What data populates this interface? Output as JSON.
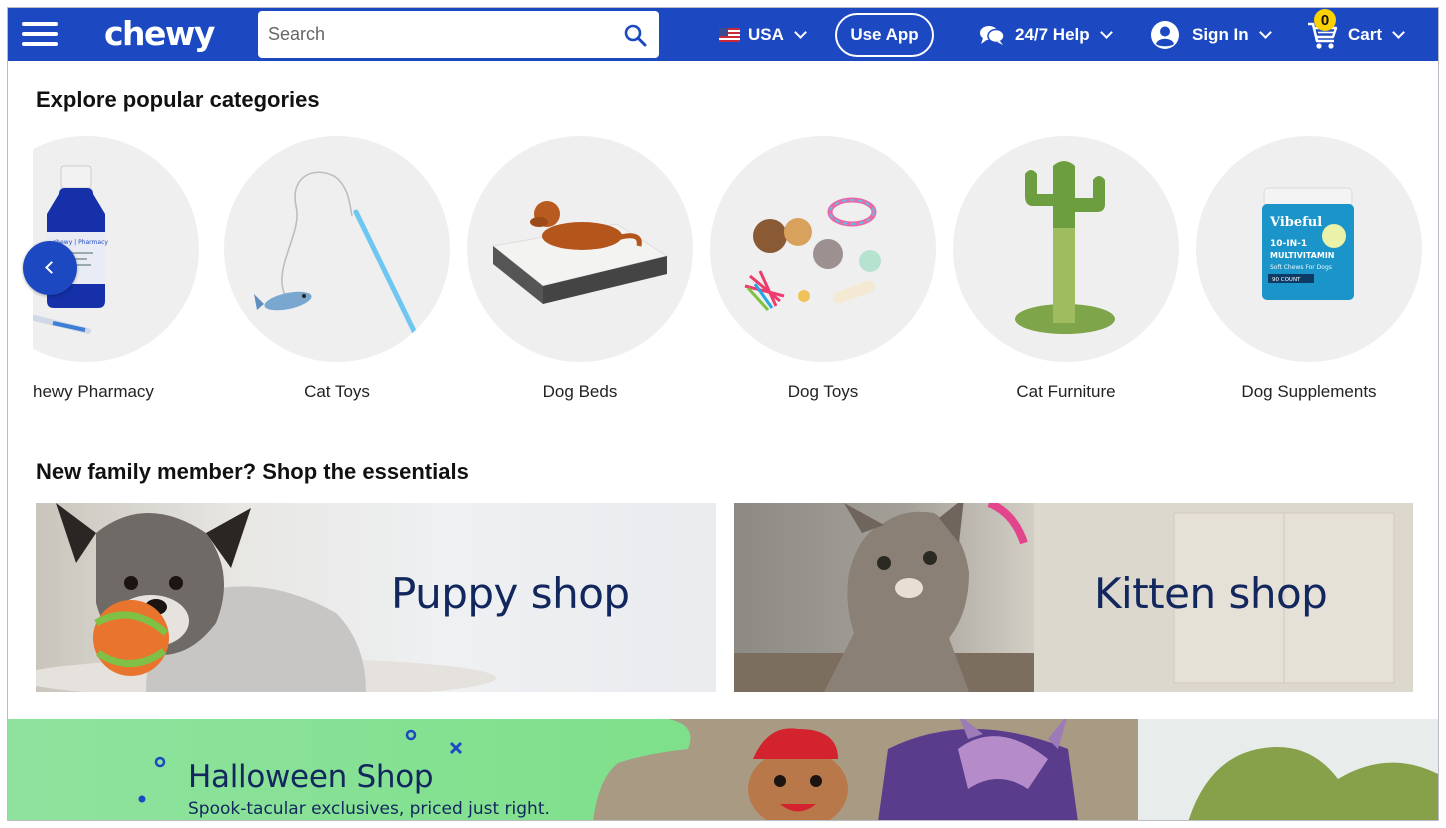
{
  "header": {
    "logo": "chewy",
    "search_placeholder": "Search",
    "country_label": "USA",
    "use_app_label": "Use App",
    "help_label": "24/7 Help",
    "sign_in_label": "Sign In",
    "cart_label": "Cart",
    "cart_count": "0",
    "brand_color": "#1c49c2",
    "badge_color": "#fcd100"
  },
  "categories_section": {
    "title": "Explore popular categories",
    "items": [
      {
        "label": "hewy Pharmacy",
        "icon": "pharmacy-bottle"
      },
      {
        "label": "Cat Toys",
        "icon": "cat-wand-toy"
      },
      {
        "label": "Dog Beds",
        "icon": "dog-bed"
      },
      {
        "label": "Dog Toys",
        "icon": "dog-toys"
      },
      {
        "label": "Cat Furniture",
        "icon": "cactus-cat-tree"
      },
      {
        "label": "Dog Supplements",
        "icon": "supplement-jar"
      }
    ],
    "pharmacy_bottle_label": "chewy | Pharmacy",
    "supplement_brand": "Vibeful",
    "supplement_line1": "10-IN-1",
    "supplement_line2": "MULTIVITAMIN",
    "supplement_line3": "Soft Chews For Dogs",
    "supplement_count": "90 COUNT"
  },
  "essentials_section": {
    "title": "New family member? Shop the essentials",
    "puppy_label": "Puppy shop",
    "kitten_label": "Kitten shop"
  },
  "halloween_banner": {
    "title": "Halloween Shop",
    "subtitle": "Spook-tacular exclusives, priced just right."
  }
}
